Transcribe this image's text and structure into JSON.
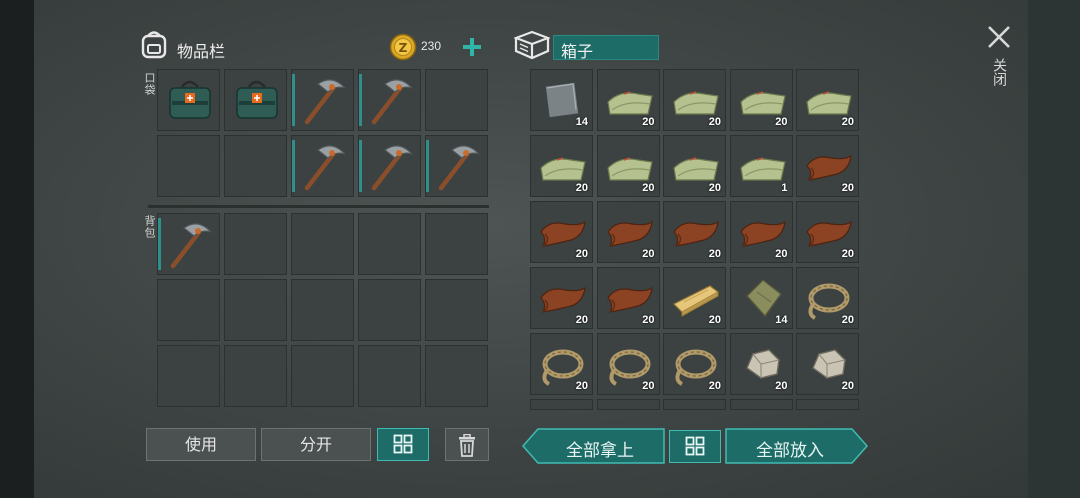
{
  "inventory": {
    "title": "物品栏",
    "coins": "230",
    "pocket_label": "口袋",
    "backpack_label": "背包",
    "pocket_slots": [
      {
        "item": "medkit-bag",
        "count": "",
        "equipped": false
      },
      {
        "item": "medkit-bag",
        "count": "",
        "equipped": false
      },
      {
        "item": "pickaxe",
        "count": "",
        "equipped": true
      },
      {
        "item": "pickaxe",
        "count": "",
        "equipped": true
      },
      {
        "item": "",
        "count": "",
        "equipped": false
      },
      {
        "item": "",
        "count": "",
        "equipped": false
      },
      {
        "item": "",
        "count": "",
        "equipped": false
      },
      {
        "item": "pickaxe",
        "count": "",
        "equipped": true
      },
      {
        "item": "pickaxe",
        "count": "",
        "equipped": true
      },
      {
        "item": "pickaxe",
        "count": "",
        "equipped": true
      }
    ],
    "backpack_slots": [
      {
        "item": "pickaxe",
        "count": "",
        "equipped": true
      },
      {
        "item": "",
        "count": "",
        "equipped": false
      },
      {
        "item": "",
        "count": "",
        "equipped": false
      },
      {
        "item": "",
        "count": "",
        "equipped": false
      },
      {
        "item": "",
        "count": "",
        "equipped": false
      },
      {
        "item": "",
        "count": "",
        "equipped": false
      },
      {
        "item": "",
        "count": "",
        "equipped": false
      },
      {
        "item": "",
        "count": "",
        "equipped": false
      },
      {
        "item": "",
        "count": "",
        "equipped": false
      },
      {
        "item": "",
        "count": "",
        "equipped": false
      },
      {
        "item": "",
        "count": "",
        "equipped": false
      },
      {
        "item": "",
        "count": "",
        "equipped": false
      },
      {
        "item": "",
        "count": "",
        "equipped": false
      },
      {
        "item": "",
        "count": "",
        "equipped": false
      },
      {
        "item": "",
        "count": "",
        "equipped": false
      }
    ],
    "use_label": "使用",
    "split_label": "分开"
  },
  "box": {
    "title": "箱子",
    "slots": [
      {
        "item": "metal-plate",
        "count": "14"
      },
      {
        "item": "cloth",
        "count": "20"
      },
      {
        "item": "cloth",
        "count": "20"
      },
      {
        "item": "cloth",
        "count": "20"
      },
      {
        "item": "cloth",
        "count": "20"
      },
      {
        "item": "cloth",
        "count": "20"
      },
      {
        "item": "cloth",
        "count": "20"
      },
      {
        "item": "cloth",
        "count": "20"
      },
      {
        "item": "cloth",
        "count": "1"
      },
      {
        "item": "leather",
        "count": "20"
      },
      {
        "item": "leather",
        "count": "20"
      },
      {
        "item": "leather",
        "count": "20"
      },
      {
        "item": "leather",
        "count": "20"
      },
      {
        "item": "leather",
        "count": "20"
      },
      {
        "item": "leather",
        "count": "20"
      },
      {
        "item": "leather",
        "count": "20"
      },
      {
        "item": "leather",
        "count": "20"
      },
      {
        "item": "plank",
        "count": "20"
      },
      {
        "item": "bag",
        "count": "14"
      },
      {
        "item": "rope",
        "count": "20"
      },
      {
        "item": "rope",
        "count": "20"
      },
      {
        "item": "rope",
        "count": "20"
      },
      {
        "item": "rope",
        "count": "20"
      },
      {
        "item": "stone",
        "count": "20"
      },
      {
        "item": "stone",
        "count": "20"
      }
    ],
    "take_all_label": "全部拿上",
    "put_all_label": "全部放入"
  },
  "close_label": "关闭",
  "colors": {
    "accent": "#1d6c67",
    "accent_border": "#3fbcb2",
    "equip_marker": "#2f8f8a"
  }
}
